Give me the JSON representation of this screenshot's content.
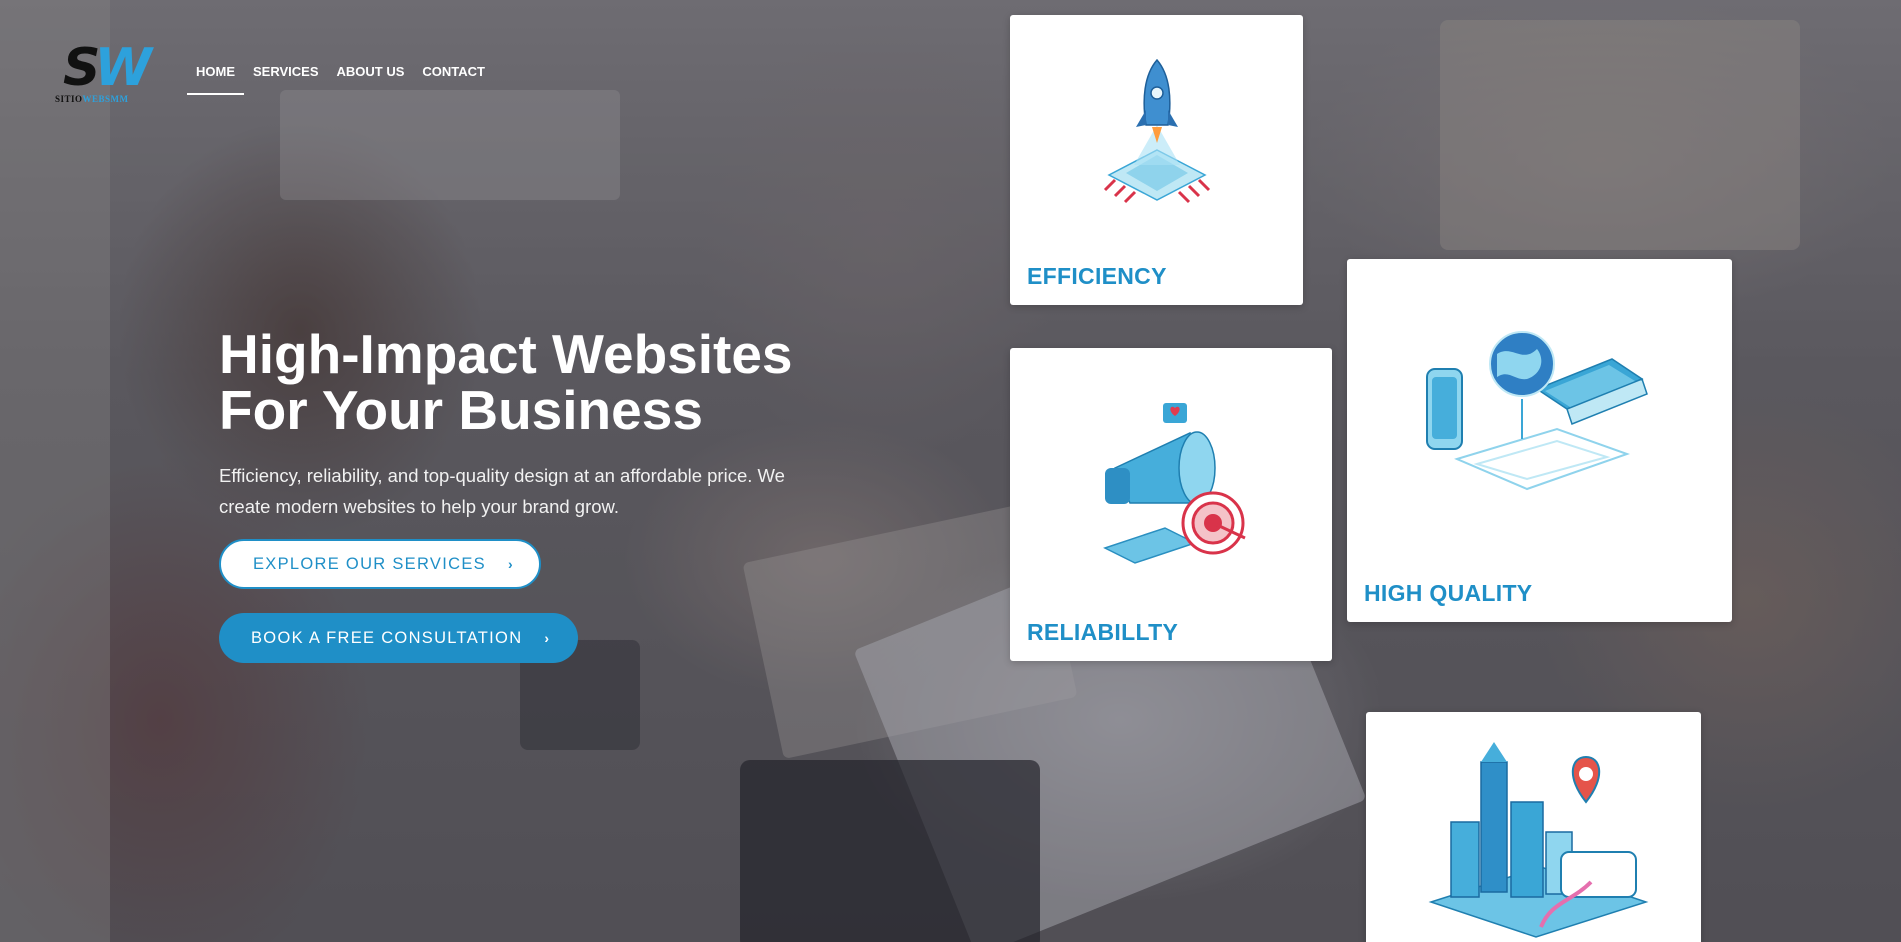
{
  "brand": {
    "logo_mark": "SW",
    "logo_sub_a": "SITIO",
    "logo_sub_b": "WEBSMM",
    "accent_color": "#1f8fc7"
  },
  "nav": {
    "items": [
      {
        "label": "HOME",
        "active": true
      },
      {
        "label": "SERVICES",
        "active": false
      },
      {
        "label": "ABOUT US",
        "active": false
      },
      {
        "label": "CONTACT",
        "active": false
      }
    ]
  },
  "hero": {
    "title_line1": "High-Impact Websites",
    "title_line2": "For Your Business",
    "subtitle_line1": "Efficiency, reliability, and top-quality design at an affordable price. We",
    "subtitle_line2": "create modern websites to help your brand grow.",
    "cta_primary": "EXPLORE OUR SERVICES",
    "cta_secondary": "BOOK A FREE CONSULTATION",
    "chevron": "›"
  },
  "cards": {
    "efficiency": {
      "label": "EFFICIENCY",
      "icon": "rocket-chip-icon"
    },
    "reliability": {
      "label": "RELIABILLTY",
      "icon": "megaphone-target-icon"
    },
    "quality": {
      "label": "HIGH QUALITY",
      "icon": "globe-devices-icon"
    },
    "location": {
      "label": "",
      "icon": "city-location-icon"
    }
  }
}
